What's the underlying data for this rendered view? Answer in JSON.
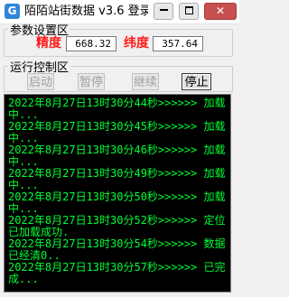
{
  "window": {
    "icon_glyph": "G",
    "title": "陌陌站街数据 v3.6   登录",
    "minimize_icon": "minimize-icon",
    "maximize_icon": "maximize-icon",
    "close_glyph": "✕"
  },
  "params": {
    "legend": "参数设置区",
    "lat_label": "精度",
    "lat_value": "668.32",
    "lon_label": "纬度",
    "lon_value": "357.64"
  },
  "controls": {
    "legend": "运行控制区",
    "start": "启动",
    "pause": "暂停",
    "resume": "继续",
    "stop": "停止"
  },
  "log": {
    "rows": [
      "2022年8月27日13时30分44秒>>>>>> 加载中...",
      "2022年8月27日13时30分45秒>>>>>> 加载中...",
      "2022年8月27日13时30分46秒>>>>>> 加载中...",
      "2022年8月27日13时30分49秒>>>>>> 加载中...",
      "2022年8月27日13时30分50秒>>>>>> 加载中...",
      "2022年8月27日13时30分52秒>>>>>> 定位已加载成功.",
      "2022年8月27日13时30分54秒>>>>>> 数据已经清0..",
      "2022年8月27日13时30分57秒>>>>>> 已完成..."
    ]
  },
  "colors": {
    "log_text": "#00ff33",
    "log_bg": "#000000",
    "label_red": "#ff1a1a",
    "app_icon": "#2f86d8"
  }
}
